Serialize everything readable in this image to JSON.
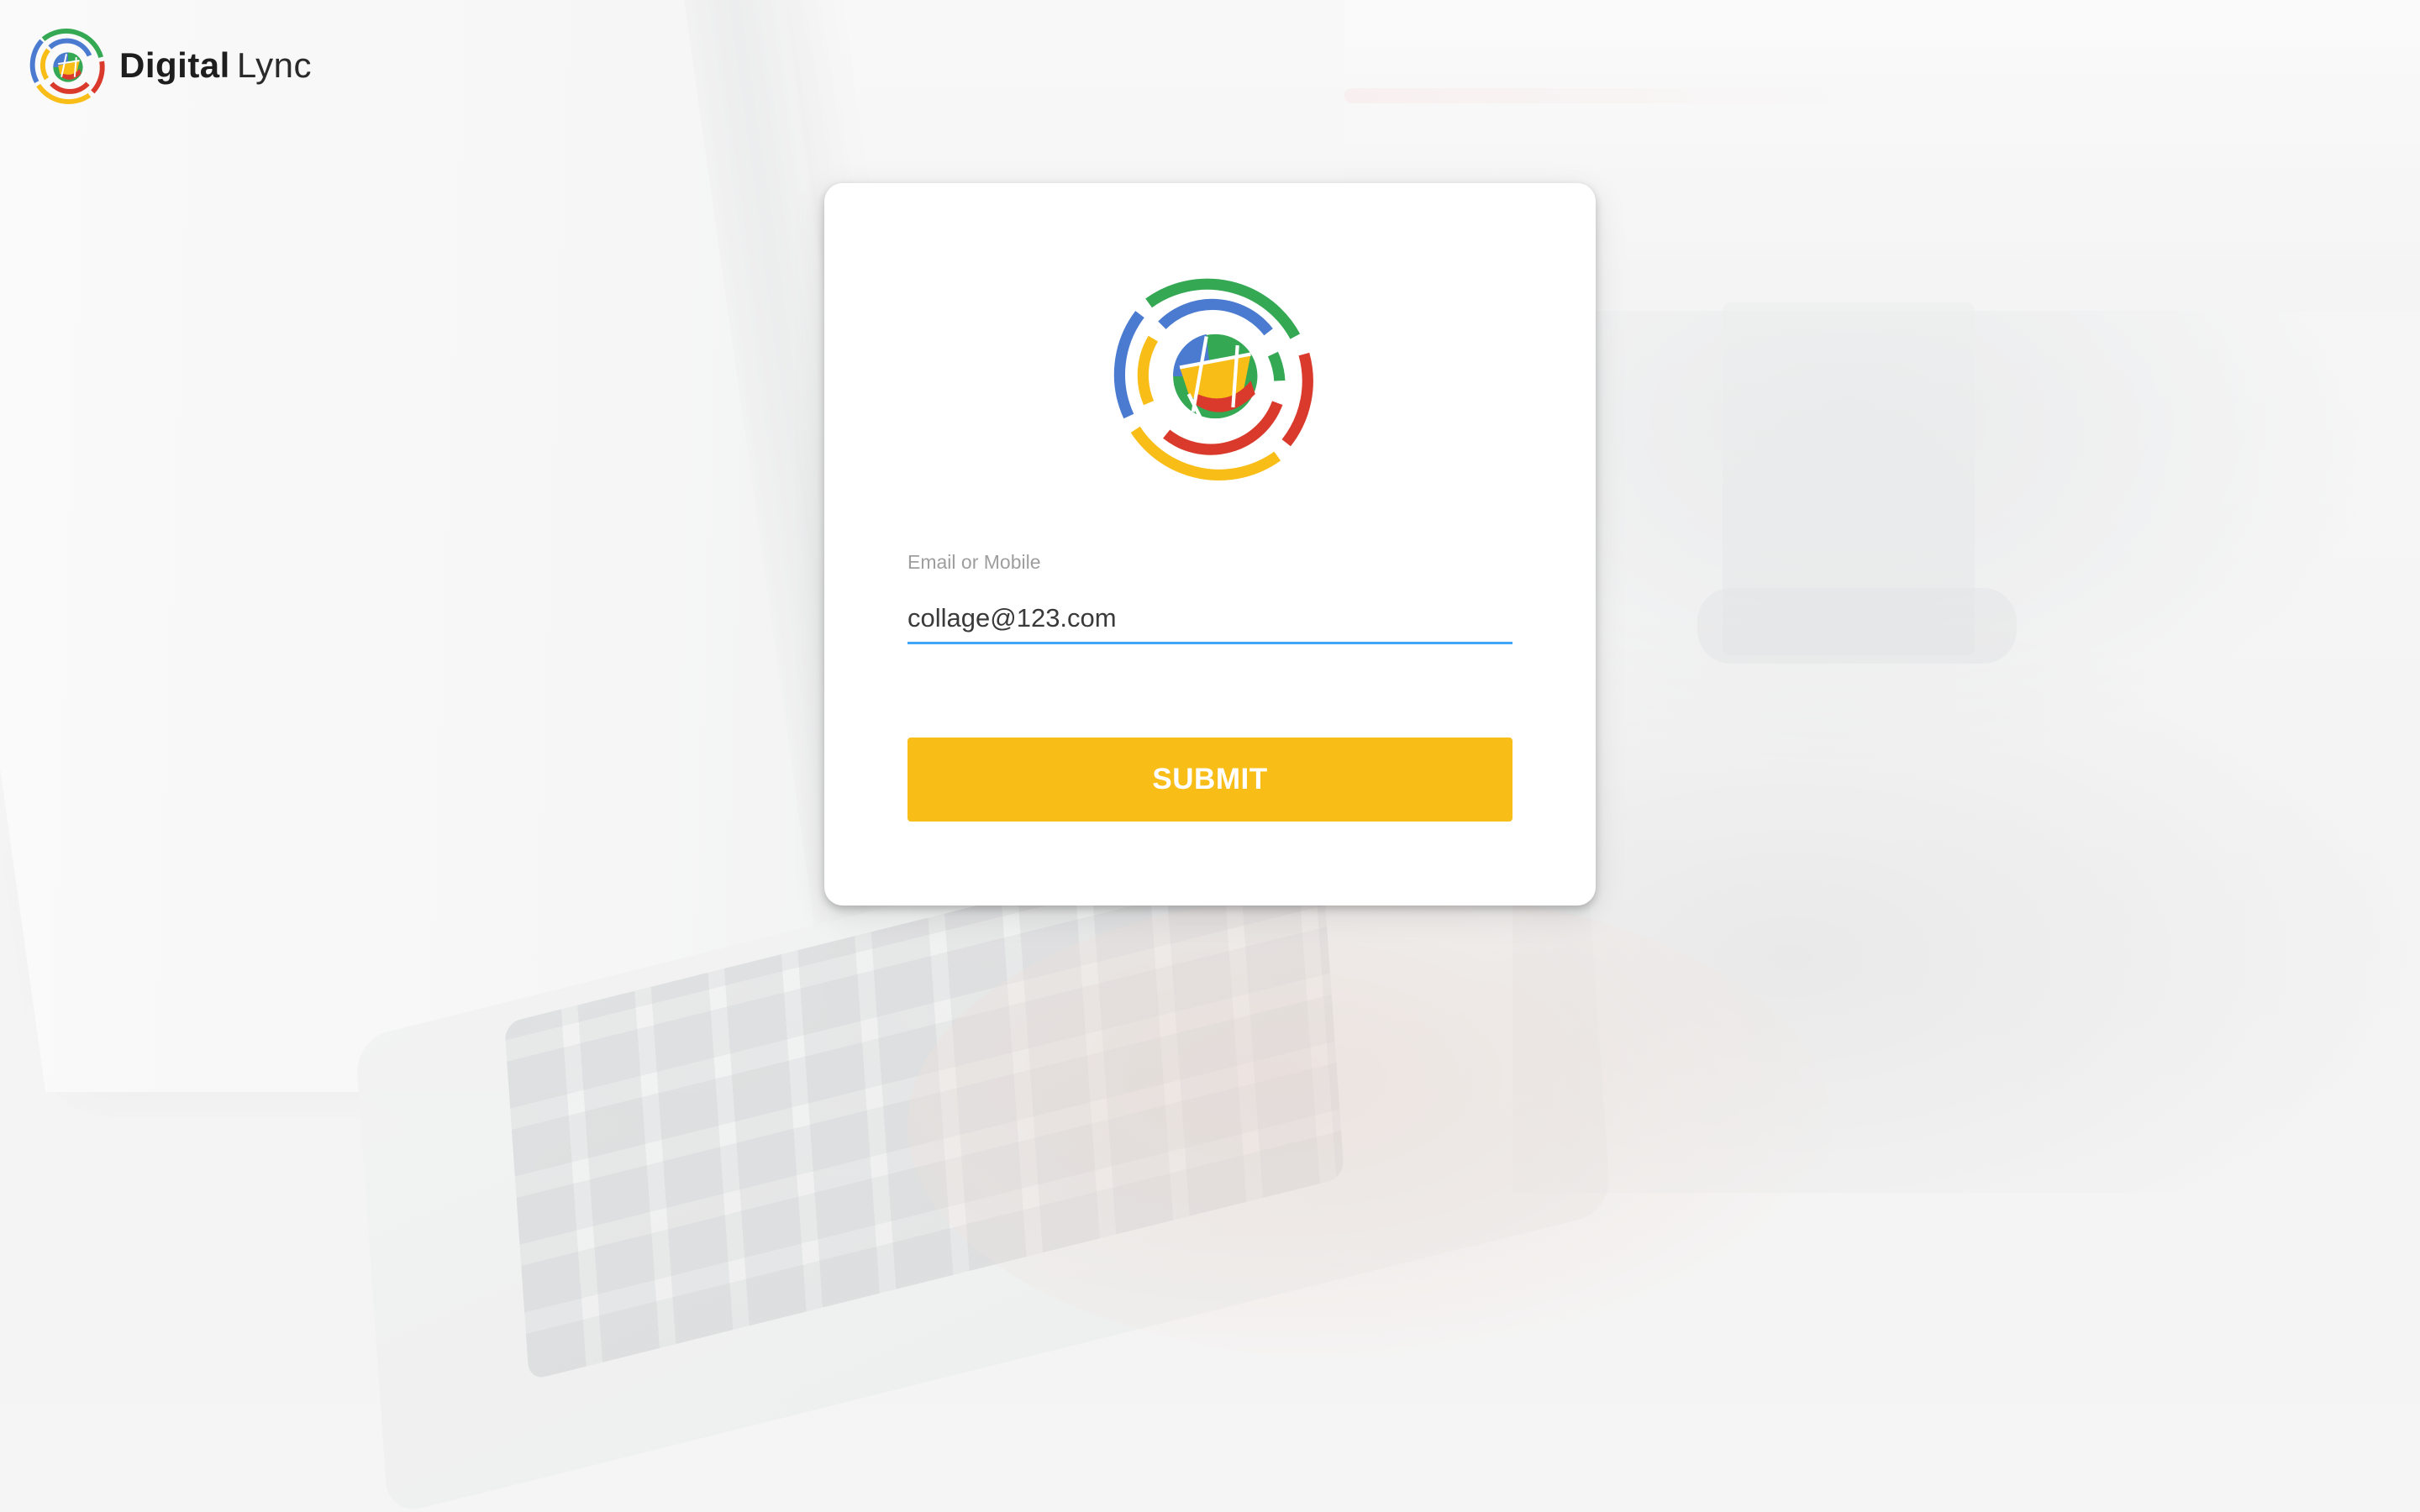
{
  "brand": {
    "name_bold": "Digital",
    "name_light": "Lync",
    "logo_icon": "digital-lync-logo-icon"
  },
  "login": {
    "logo_icon": "digital-lync-emblem-icon",
    "field_label": "Email or Mobile",
    "field_value": "collage@123.com",
    "submit_label": "SUBMIT"
  },
  "colors": {
    "accent_green": "#34a853",
    "accent_blue": "#4a7bd0",
    "accent_yellow": "#f8bd17",
    "accent_red": "#d93a2b",
    "input_underline": "#42a5f5",
    "button": "#f8bd17"
  }
}
